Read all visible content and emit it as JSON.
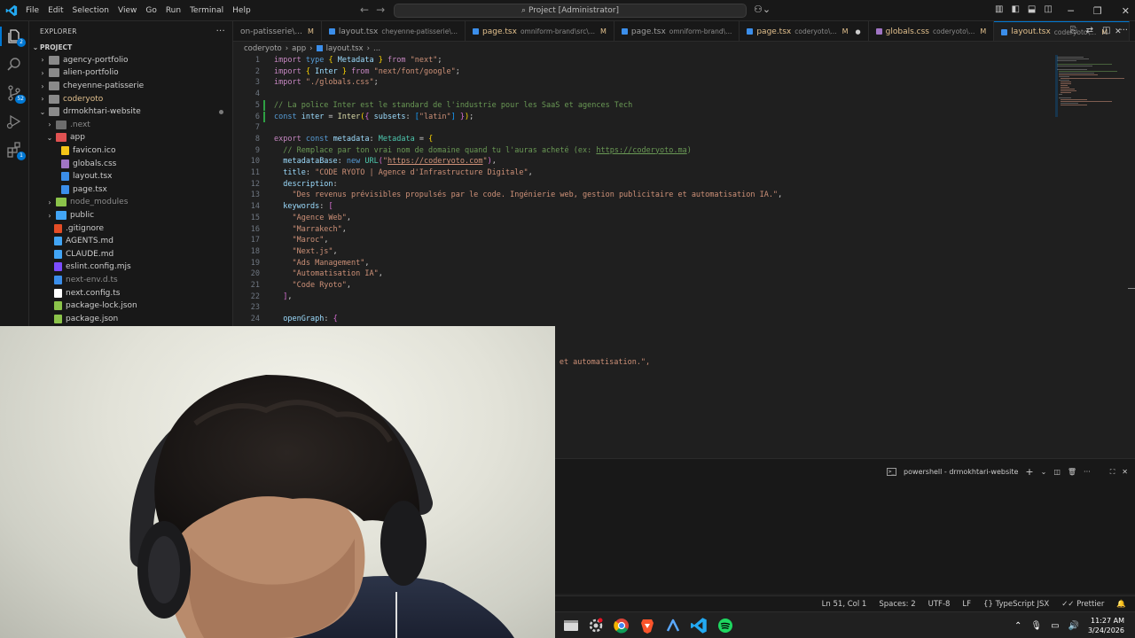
{
  "menu": [
    "File",
    "Edit",
    "Selection",
    "View",
    "Go",
    "Run",
    "Terminal",
    "Help"
  ],
  "command_center": "Project [Administrator]",
  "activity": {
    "explorer_badge": "2",
    "scm_badge": "52",
    "extensions_badge": "1"
  },
  "sidebar": {
    "title": "EXPLORER",
    "more": "···",
    "project_label": "PROJECT",
    "items": [
      {
        "label": "agency-portfolio",
        "kind": "folder",
        "depth": 1,
        "expanded": false,
        "color": "#cccccc",
        "icon_color": "#8a8a8a"
      },
      {
        "label": "alien-portfolio",
        "kind": "folder",
        "depth": 1,
        "expanded": false,
        "color": "#cccccc",
        "icon_color": "#8a8a8a"
      },
      {
        "label": "cheyenne-patisserie",
        "kind": "folder",
        "depth": 1,
        "expanded": false,
        "color": "#cccccc",
        "icon_color": "#8a8a8a"
      },
      {
        "label": "coderyoto",
        "kind": "folder",
        "depth": 1,
        "expanded": false,
        "color": "#e2c08d",
        "icon_color": "#8a8a8a"
      },
      {
        "label": "drmokhtari-website",
        "kind": "folder",
        "depth": 1,
        "expanded": true,
        "color": "#cccccc",
        "icon_color": "#8a8a8a",
        "modified": true
      },
      {
        "label": ".next",
        "kind": "folder",
        "depth": 2,
        "expanded": false,
        "color": "#8b8b8b",
        "icon_color": "#6d6d6d"
      },
      {
        "label": "app",
        "kind": "folder",
        "depth": 2,
        "expanded": true,
        "color": "#cccccc",
        "icon_color": "#e05252"
      },
      {
        "label": "favicon.ico",
        "kind": "file",
        "depth": 3,
        "color": "#cccccc",
        "icon_color": "#f5c518"
      },
      {
        "label": "globals.css",
        "kind": "file",
        "depth": 3,
        "color": "#cccccc",
        "icon_color": "#a074c4"
      },
      {
        "label": "layout.tsx",
        "kind": "file",
        "depth": 3,
        "color": "#cccccc",
        "icon_color": "#3b8eea"
      },
      {
        "label": "page.tsx",
        "kind": "file",
        "depth": 3,
        "color": "#cccccc",
        "icon_color": "#3b8eea"
      },
      {
        "label": "node_modules",
        "kind": "folder",
        "depth": 2,
        "expanded": false,
        "color": "#8b8b8b",
        "icon_color": "#8bc34a"
      },
      {
        "label": "public",
        "kind": "folder",
        "depth": 2,
        "expanded": false,
        "color": "#cccccc",
        "icon_color": "#42a5f5"
      },
      {
        "label": ".gitignore",
        "kind": "file",
        "depth": 2,
        "color": "#cccccc",
        "icon_color": "#e44d26"
      },
      {
        "label": "AGENTS.md",
        "kind": "file",
        "depth": 2,
        "color": "#cccccc",
        "icon_color": "#42a5f5"
      },
      {
        "label": "CLAUDE.md",
        "kind": "file",
        "depth": 2,
        "color": "#cccccc",
        "icon_color": "#42a5f5"
      },
      {
        "label": "eslint.config.mjs",
        "kind": "file",
        "depth": 2,
        "color": "#cccccc",
        "icon_color": "#7c4dff"
      },
      {
        "label": "next-env.d.ts",
        "kind": "file",
        "depth": 2,
        "color": "#8b8b8b",
        "icon_color": "#3b8eea"
      },
      {
        "label": "next.config.ts",
        "kind": "file",
        "depth": 2,
        "color": "#cccccc",
        "icon_color": "#ffffff"
      },
      {
        "label": "package-lock.json",
        "kind": "file",
        "depth": 2,
        "color": "#cccccc",
        "icon_color": "#8bc34a"
      },
      {
        "label": "package.json",
        "kind": "file",
        "depth": 2,
        "color": "#cccccc",
        "icon_color": "#8bc34a"
      }
    ]
  },
  "tabs": [
    {
      "label": "on-patisserie\\...",
      "desc": "",
      "mod": "M",
      "icon_color": "#3b8eea",
      "active": false
    },
    {
      "label": "layout.tsx",
      "desc": "cheyenne-patisserie\\...",
      "mod": "",
      "icon_color": "#3b8eea",
      "active": false
    },
    {
      "label": "page.tsx",
      "desc": "omniform-brand\\src\\...",
      "mod": "M",
      "icon_color": "#3b8eea",
      "active": false,
      "color": "#e2c08d"
    },
    {
      "label": "page.tsx",
      "desc": "omniform-brand\\...",
      "mod": "",
      "icon_color": "#3b8eea",
      "active": false
    },
    {
      "label": "page.tsx",
      "desc": "coderyoto\\...",
      "mod": "M",
      "icon_color": "#3b8eea",
      "active": false,
      "color": "#e2c08d",
      "dirty": true
    },
    {
      "label": "globals.css",
      "desc": "coderyoto\\...",
      "mod": "M",
      "icon_color": "#a074c4",
      "active": false,
      "color": "#e2c08d"
    },
    {
      "label": "layout.tsx",
      "desc": "coderyoto\\...",
      "mod": "M",
      "icon_color": "#3b8eea",
      "active": true,
      "color": "#e2c08d"
    }
  ],
  "breadcrumb": [
    "coderyoto",
    "app",
    "layout.tsx",
    "..."
  ],
  "code_lines": [
    {
      "n": "1",
      "html": "<span class='kw'>import</span> <span class='k'>type</span> <span class='y'>{</span> <span class='v'>Metadata</span> <span class='y'>}</span> <span class='kw'>from</span> <span class='s'>\"next\"</span>;"
    },
    {
      "n": "2",
      "html": "<span class='kw'>import</span> <span class='y'>{</span> <span class='v'>Inter</span> <span class='y'>}</span> <span class='kw'>from</span> <span class='s'>\"next/font/google\"</span>;"
    },
    {
      "n": "3",
      "html": "<span class='kw'>import</span> <span class='s'>\"./globals.css\"</span>;"
    },
    {
      "n": "4",
      "html": ""
    },
    {
      "n": "5",
      "html": "<span class='c'>// La police Inter est le standard de l'industrie pour les SaaS et agences Tech</span>"
    },
    {
      "n": "6",
      "html": "<span class='k'>const</span> <span class='v'>inter</span> = <span class='f'>Inter</span><span class='y'>(</span><span class='p'>{</span> <span class='v'>subsets</span>: <span class='pb'>[</span><span class='s'>\"latin\"</span><span class='pb'>]</span> <span class='p'>}</span><span class='y'>)</span>;"
    },
    {
      "n": "7",
      "html": ""
    },
    {
      "n": "8",
      "html": "<span class='kw'>export</span> <span class='k'>const</span> <span class='v'>metadata</span>: <span class='ty'>Metadata</span> = <span class='y'>{</span>"
    },
    {
      "n": "9",
      "html": "  <span class='c'>// Remplace par ton vrai nom de domaine quand tu l'auras acheté (ex: <span class='u'>https://coderyoto.ma</span>)</span>"
    },
    {
      "n": "10",
      "html": "  <span class='v'>metadataBase</span>: <span class='k'>new</span> <span class='ty'>URL</span><span class='p'>(</span><span class='s'>\"<span class='u'>https://coderyoto.com</span>\"</span><span class='p'>)</span>,"
    },
    {
      "n": "11",
      "html": "  <span class='v'>title</span>: <span class='s'>\"CODE RYOTO | Agence d'Infrastructure Digitale\"</span>,"
    },
    {
      "n": "12",
      "html": "  <span class='v'>description</span>:"
    },
    {
      "n": "13",
      "html": "    <span class='s'>\"Des revenus prévisibles propulsés par le code. Ingénierie web, gestion publicitaire et automatisation IA.\"</span>,"
    },
    {
      "n": "14",
      "html": "  <span class='v'>keywords</span>: <span class='p'>[</span>"
    },
    {
      "n": "15",
      "html": "    <span class='s'>\"Agence Web\"</span>,"
    },
    {
      "n": "16",
      "html": "    <span class='s'>\"Marrakech\"</span>,"
    },
    {
      "n": "17",
      "html": "    <span class='s'>\"Maroc\"</span>,"
    },
    {
      "n": "18",
      "html": "    <span class='s'>\"Next.js\"</span>,"
    },
    {
      "n": "19",
      "html": "    <span class='s'>\"Ads Management\"</span>,"
    },
    {
      "n": "20",
      "html": "    <span class='s'>\"Automatisation IA\"</span>,"
    },
    {
      "n": "21",
      "html": "    <span class='s'>\"Code Ryoto\"</span>,"
    },
    {
      "n": "22",
      "html": "  <span class='p'>]</span>,"
    },
    {
      "n": "23",
      "html": ""
    },
    {
      "n": "24",
      "html": "  <span class='v'>openGraph</span>: <span class='p'>{</span>"
    }
  ],
  "partial_line": "ie web et automatisation.\",",
  "terminal": {
    "label": "powershell - drmokhtari-website"
  },
  "status": {
    "position": "Ln 51, Col 1",
    "spaces": "Spaces: 2",
    "encoding": "UTF-8",
    "eol": "LF",
    "language": "TypeScript JSX",
    "formatter": "Prettier"
  },
  "clock": {
    "time": "11:27 AM",
    "date": "3/24/2026"
  }
}
